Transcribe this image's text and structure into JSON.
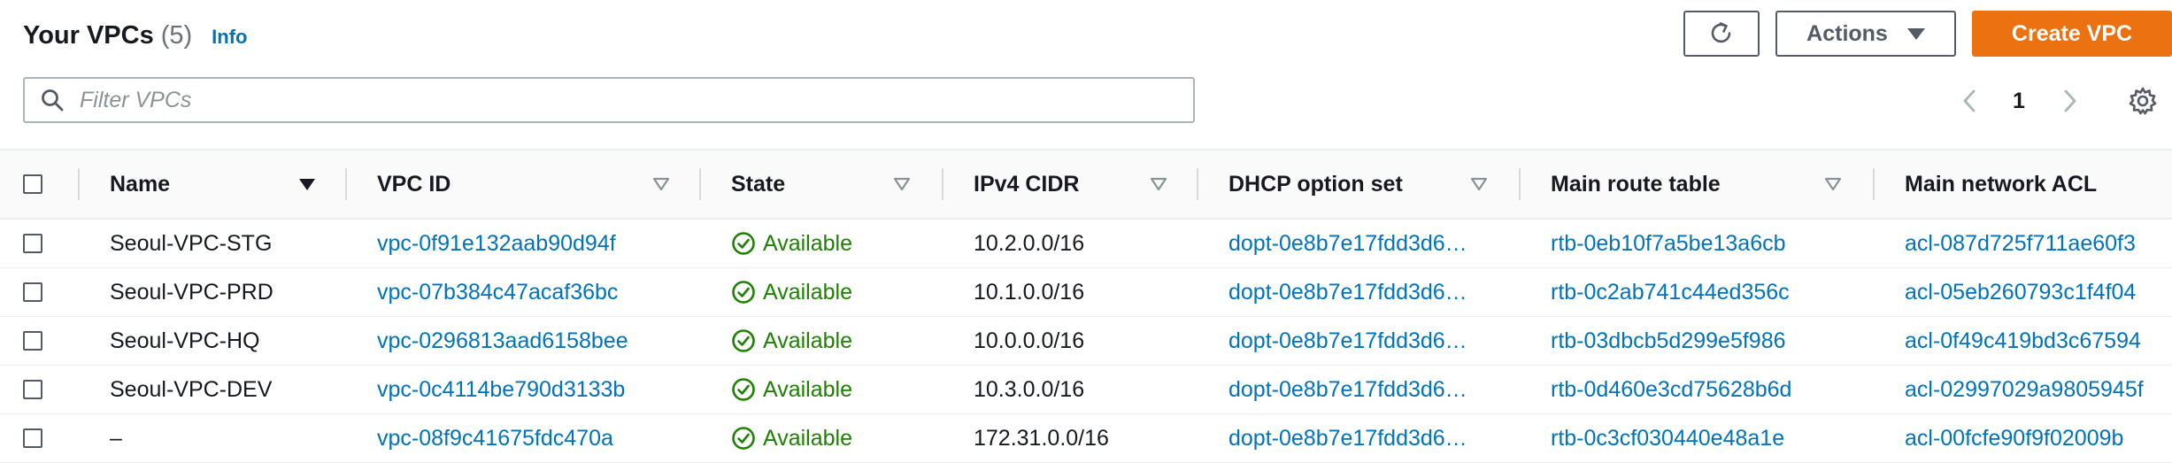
{
  "header": {
    "title": "Your VPCs",
    "count": "(5)",
    "info": "Info"
  },
  "toolbar": {
    "actions_label": "Actions",
    "create_label": "Create VPC"
  },
  "search": {
    "placeholder": "Filter VPCs",
    "value": ""
  },
  "pagination": {
    "current_page": "1"
  },
  "table": {
    "columns": [
      "Name",
      "VPC ID",
      "State",
      "IPv4 CIDR",
      "DHCP option set",
      "Main route table",
      "Main network ACL"
    ],
    "rows": [
      {
        "name": "Seoul-VPC-STG",
        "vpc_id": "vpc-0f91e132aab90d94f",
        "state": "Available",
        "cidr": "10.2.0.0/16",
        "dhcp": "dopt-0e8b7e17fdd3d6…",
        "route_table": "rtb-0eb10f7a5be13a6cb",
        "acl": "acl-087d725f711ae60f3"
      },
      {
        "name": "Seoul-VPC-PRD",
        "vpc_id": "vpc-07b384c47acaf36bc",
        "state": "Available",
        "cidr": "10.1.0.0/16",
        "dhcp": "dopt-0e8b7e17fdd3d6…",
        "route_table": "rtb-0c2ab741c44ed356c",
        "acl": "acl-05eb260793c1f4f04"
      },
      {
        "name": "Seoul-VPC-HQ",
        "vpc_id": "vpc-0296813aad6158bee",
        "state": "Available",
        "cidr": "10.0.0.0/16",
        "dhcp": "dopt-0e8b7e17fdd3d6…",
        "route_table": "rtb-03dbcb5d299e5f986",
        "acl": "acl-0f49c419bd3c67594"
      },
      {
        "name": "Seoul-VPC-DEV",
        "vpc_id": "vpc-0c4114be790d3133b",
        "state": "Available",
        "cidr": "10.3.0.0/16",
        "dhcp": "dopt-0e8b7e17fdd3d6…",
        "route_table": "rtb-0d460e3cd75628b6d",
        "acl": "acl-02997029a9805945f"
      },
      {
        "name": "–",
        "vpc_id": "vpc-08f9c41675fdc470a",
        "state": "Available",
        "cidr": "172.31.0.0/16",
        "dhcp": "dopt-0e8b7e17fdd3d6…",
        "route_table": "rtb-0c3cf030440e48a1e",
        "acl": "acl-00fcfe90f9f02009b"
      }
    ]
  },
  "icons": {
    "refresh": "refresh-icon",
    "dropdown": "caret-down-icon",
    "search": "search-icon",
    "prev": "chevron-left-icon",
    "next": "chevron-right-icon",
    "settings": "gear-icon",
    "status": "status-available-icon",
    "sort": "sort-icon"
  },
  "colors": {
    "primary": "#ec7211",
    "link": "#0073bb",
    "success": "#1d8102",
    "text": "#16191f",
    "muted": "#687078"
  }
}
